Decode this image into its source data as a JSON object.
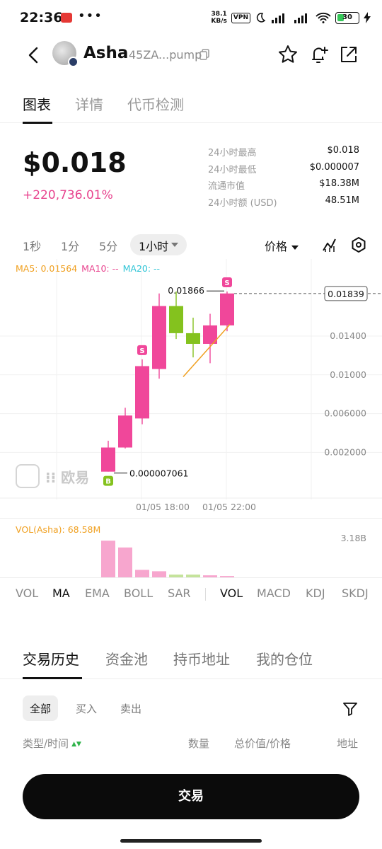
{
  "status_bar": {
    "time": "22:36",
    "dots": "•••",
    "speed_top": "38.1",
    "speed_unit": "KB/s",
    "vpn": "VPN",
    "battery": "30"
  },
  "header": {
    "token_name": "Asha",
    "token_address": "45ZA...pump",
    "icons": [
      "back-arrow-icon",
      "copy-icon",
      "star-icon",
      "bell-plus-icon",
      "share-icon"
    ]
  },
  "tabs": {
    "items": [
      "图表",
      "详情",
      "代币检测"
    ],
    "active": 0
  },
  "price": {
    "value": "$0.018",
    "change": "+220,736.01%",
    "change_color": "#e8458f"
  },
  "stats": [
    {
      "label": "24小时最高",
      "value": "$0.018"
    },
    {
      "label": "24小时最低",
      "value": "$0.000007"
    },
    {
      "label": "流通市值",
      "value": "$18.38M"
    },
    {
      "label": "24小时额 (USD)",
      "value": "48.51M"
    }
  ],
  "chart_toolbar": {
    "intervals": [
      "1秒",
      "1分",
      "5分"
    ],
    "active_interval": "1小时",
    "price_dropdown": "价格",
    "icons": [
      "indicator-icon",
      "settings-icon"
    ]
  },
  "chart_data": {
    "type": "candlestick",
    "legend": {
      "ma5": "MA5: 0.01564",
      "ma10": "MA10: --",
      "ma20": "MA20: --"
    },
    "y_ticks": [
      "0.01400",
      "0.01000",
      "0.006000",
      "0.002000"
    ],
    "x_ticks": [
      "01/05 18:00",
      "01/05 22:00"
    ],
    "current_price_label": "0.01839",
    "high_label": "0.01866",
    "low_label": "0.000007061",
    "ylim": [
      -0.0025,
      0.0205
    ],
    "up_color": "#f0479a",
    "down_color": "#84c21e",
    "candles": [
      {
        "open": 7.1e-06,
        "close": 0.0025,
        "high": 0.0032,
        "low": 7.1e-06,
        "dir": "up"
      },
      {
        "open": 0.0025,
        "close": 0.0058,
        "high": 0.0066,
        "low": 0.0024,
        "dir": "up"
      },
      {
        "open": 0.0055,
        "close": 0.0109,
        "high": 0.0116,
        "low": 0.0049,
        "dir": "up"
      },
      {
        "open": 0.0106,
        "close": 0.0171,
        "high": 0.0184,
        "low": 0.0096,
        "dir": "up"
      },
      {
        "open": 0.0171,
        "close": 0.0143,
        "high": 0.0186,
        "low": 0.0137,
        "dir": "down"
      },
      {
        "open": 0.0143,
        "close": 0.0132,
        "high": 0.0159,
        "low": 0.0118,
        "dir": "down"
      },
      {
        "open": 0.0132,
        "close": 0.0151,
        "high": 0.0163,
        "low": 0.0112,
        "dir": "up"
      },
      {
        "open": 0.0151,
        "close": 0.0184,
        "high": 0.0186,
        "low": 0.0145,
        "dir": "up"
      }
    ],
    "ma5_line": [
      [
        5,
        0.0098
      ],
      [
        7,
        0.0152
      ]
    ],
    "markers": [
      {
        "candle": 0,
        "label": "B",
        "color": "#84c21e",
        "position": "below"
      },
      {
        "candle": 2,
        "label": "S",
        "color": "#f0479a",
        "position": "above"
      },
      {
        "candle": 7,
        "label": "S",
        "color": "#f0479a",
        "position": "above"
      }
    ]
  },
  "volume": {
    "legend": "VOL(Asha): 68.58M",
    "max_label": "3.18B",
    "bars": [
      {
        "value": 0.55,
        "color": "#f7a6ce"
      },
      {
        "value": 0.45,
        "color": "#f7a6ce"
      },
      {
        "value": 0.12,
        "color": "#f7a6ce"
      },
      {
        "value": 0.1,
        "color": "#f7a6ce"
      },
      {
        "value": 0.05,
        "color": "#c4e39b"
      },
      {
        "value": 0.05,
        "color": "#c4e39b"
      },
      {
        "value": 0.04,
        "color": "#f7a6ce"
      },
      {
        "value": 0.03,
        "color": "#f7a6ce"
      }
    ]
  },
  "indicators": {
    "main": [
      "VOL",
      "MA",
      "EMA",
      "BOLL",
      "SAR"
    ],
    "sub": [
      "VOL",
      "MACD",
      "KDJ",
      "SKDJ"
    ],
    "active_main": "MA",
    "active_sub": "VOL"
  },
  "trade_tabs": {
    "items": [
      "交易历史",
      "资金池",
      "持币地址",
      "我的仓位"
    ],
    "active": 0
  },
  "filters": {
    "items": [
      "全部",
      "买入",
      "卖出"
    ],
    "active": 0
  },
  "table_header": {
    "type_time": "类型/时间",
    "sort_glyph": "▲▼",
    "amount": "数量",
    "total_price": "总价值/价格",
    "address": "地址"
  },
  "trade_button": "交易"
}
